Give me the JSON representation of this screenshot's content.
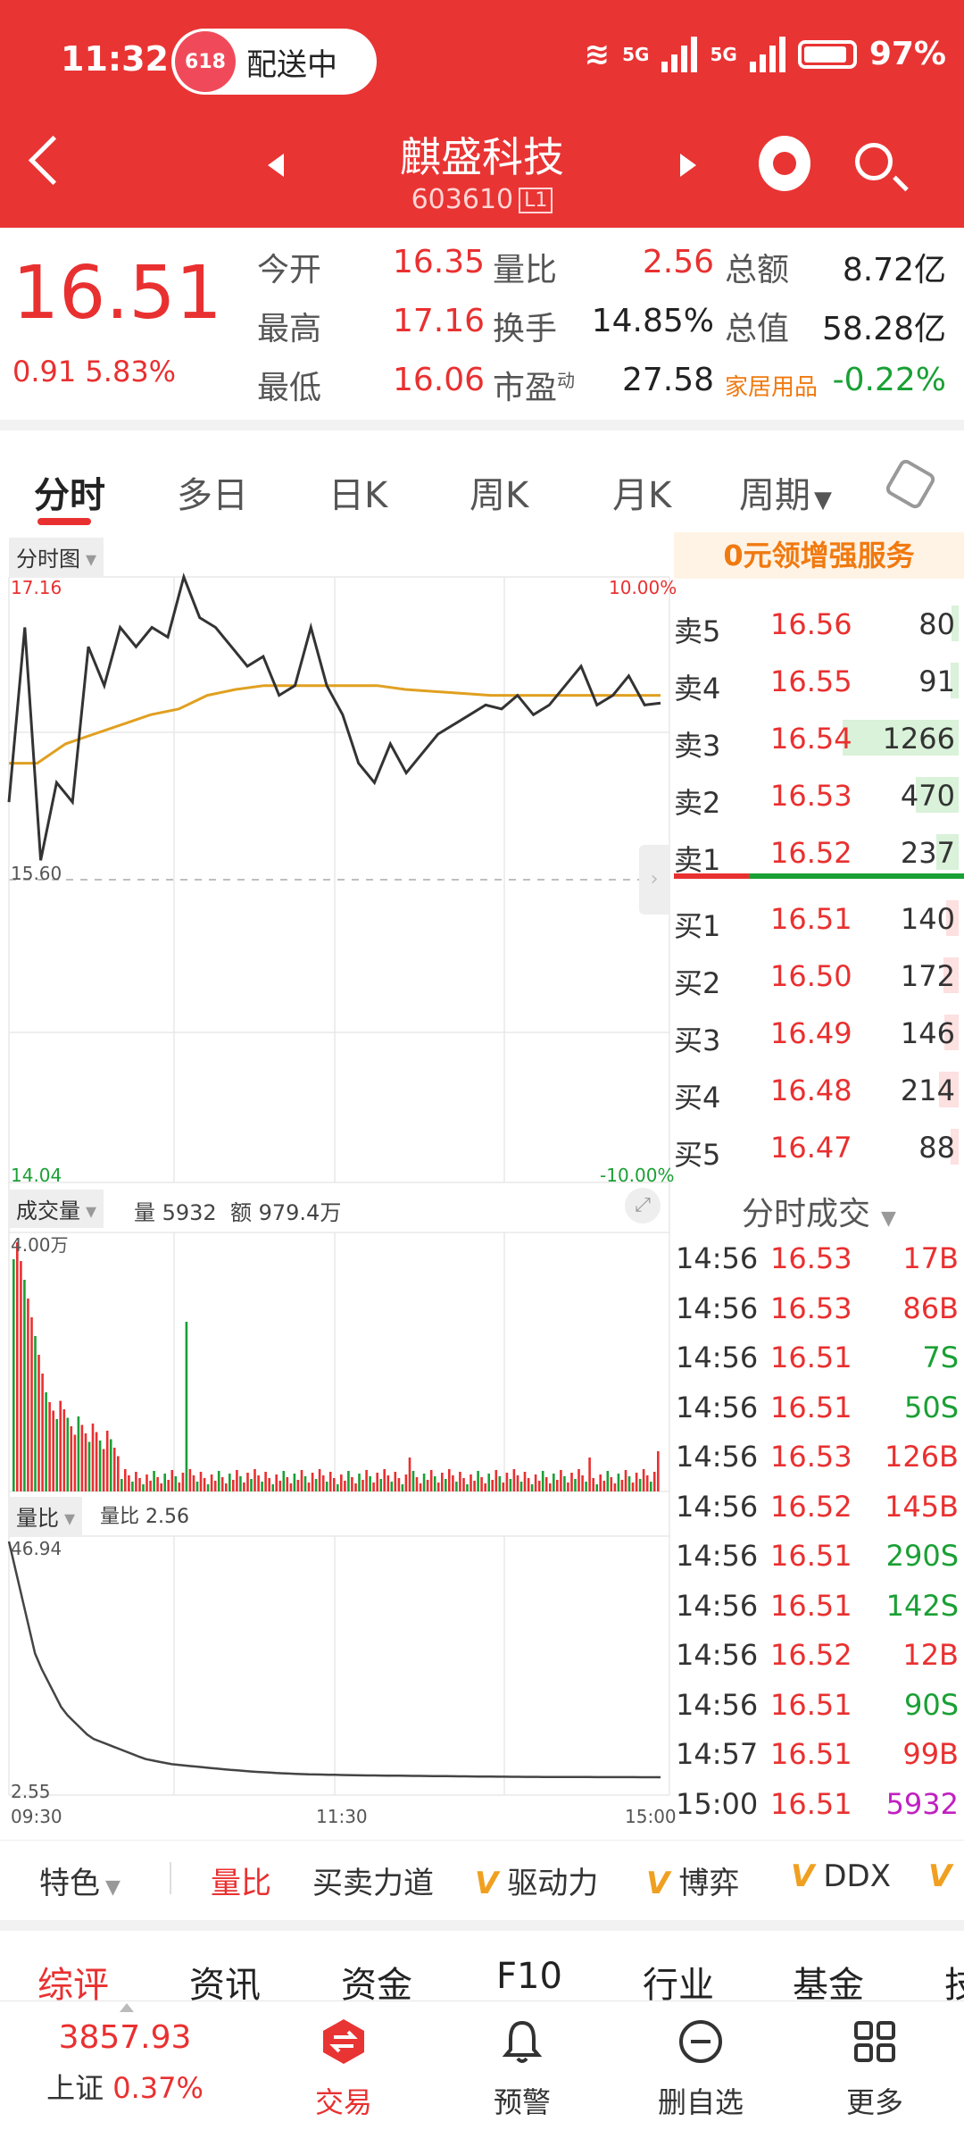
{
  "status_bar": {
    "time": "11:32",
    "delivery_pill": "配送中",
    "pill_logo": "618",
    "network1": "5G",
    "network2": "5G",
    "battery": "97%"
  },
  "header": {
    "title": "麒盛科技",
    "code": "603610",
    "level": "L1"
  },
  "quote": {
    "price": "16.51",
    "change": "0.91",
    "change_pct": "5.83%",
    "rows": [
      [
        {
          "label": "今开",
          "value": "16.35",
          "color": "red"
        },
        {
          "label": "量比",
          "value": "2.56",
          "color": "red"
        },
        {
          "label": "总额",
          "value": "8.72亿",
          "color": "black"
        }
      ],
      [
        {
          "label": "最高",
          "value": "17.16",
          "color": "red"
        },
        {
          "label": "换手",
          "value": "14.85%",
          "color": "black"
        },
        {
          "label": "总值",
          "value": "58.28亿",
          "color": "black"
        }
      ],
      [
        {
          "label": "最低",
          "value": "16.06",
          "color": "red"
        },
        {
          "label": "市盈",
          "sup": "动",
          "value": "27.58",
          "color": "black"
        },
        {
          "label": "家居用品",
          "value": "-0.22%",
          "color": "green"
        }
      ]
    ]
  },
  "tabs": [
    "分时",
    "多日",
    "日K",
    "周K",
    "月K",
    "周期"
  ],
  "chart": {
    "price_badge": "分时图",
    "max_price": "17.16",
    "mid_price": "15.60",
    "min_price": "14.04",
    "max_pct": "10.00%",
    "min_pct": "-10.00%",
    "vol_badge": "成交量",
    "vol_info": "量 5932",
    "amt_info": "额 979.4万",
    "vol_max": "4.00万",
    "ratio_badge": "量比",
    "ratio_info": "量比 2.56",
    "ratio_max": "46.94",
    "ratio_min": "2.55",
    "times": [
      "09:30",
      "11:30",
      "15:00"
    ]
  },
  "chart_data": {
    "type": "line",
    "title": "",
    "ylim": [
      14.04,
      17.16
    ],
    "series": [
      {
        "name": "",
        "values": [
          16.0,
          16.9,
          15.7,
          16.1,
          16.0,
          16.8,
          16.6,
          16.9,
          16.8,
          16.9,
          16.85,
          17.16,
          16.95,
          16.9,
          16.8,
          16.7,
          16.75,
          16.55,
          16.6,
          16.9,
          16.6,
          16.45,
          16.2,
          16.1,
          16.3,
          16.15,
          16.25,
          16.35,
          16.4,
          16.45,
          16.5,
          16.48,
          16.55,
          16.45,
          16.5,
          16.6,
          16.7,
          16.5,
          16.55,
          16.65,
          16.5,
          16.51
        ]
      },
      {
        "name": "",
        "values": [
          16.2,
          16.2,
          16.3,
          16.35,
          16.4,
          16.45,
          16.48,
          16.55,
          16.58,
          16.6,
          16.6,
          16.6,
          16.6,
          16.6,
          16.58,
          16.57,
          16.56,
          16.55,
          16.55,
          16.55,
          16.55,
          16.55,
          16.55,
          16.55
        ]
      }
    ],
    "volume_ratio": [
      46.94,
      25,
      15,
      10,
      8,
      6,
      5,
      4.5,
      4,
      3.6,
      3.3,
      3.1,
      3.0,
      2.9,
      2.85,
      2.8,
      2.75,
      2.7,
      2.65,
      2.62,
      2.6,
      2.58,
      2.57,
      2.56,
      2.55
    ]
  },
  "order_book": {
    "promo": "0元领增强服务",
    "asks": [
      {
        "label": "卖5",
        "price": "16.56",
        "vol": "80",
        "w": 0.06
      },
      {
        "label": "卖4",
        "price": "16.55",
        "vol": "91",
        "w": 0.07
      },
      {
        "label": "卖3",
        "price": "16.54",
        "vol": "1266",
        "w": 1.0
      },
      {
        "label": "卖2",
        "price": "16.53",
        "vol": "470",
        "w": 0.37
      },
      {
        "label": "卖1",
        "price": "16.52",
        "vol": "237",
        "w": 0.19
      }
    ],
    "bids": [
      {
        "label": "买1",
        "price": "16.51",
        "vol": "140",
        "w": 0.11
      },
      {
        "label": "买2",
        "price": "16.50",
        "vol": "172",
        "w": 0.13
      },
      {
        "label": "买3",
        "price": "16.49",
        "vol": "146",
        "w": 0.12
      },
      {
        "label": "买4",
        "price": "16.48",
        "vol": "214",
        "w": 0.17
      },
      {
        "label": "买5",
        "price": "16.47",
        "vol": "88",
        "w": 0.07
      }
    ],
    "trans_title": "分时成交",
    "trades": [
      {
        "t": "14:56",
        "p": "16.53",
        "v": "17B",
        "c": "red"
      },
      {
        "t": "14:56",
        "p": "16.53",
        "v": "86B",
        "c": "red"
      },
      {
        "t": "14:56",
        "p": "16.51",
        "v": "7S",
        "c": "green"
      },
      {
        "t": "14:56",
        "p": "16.51",
        "v": "50S",
        "c": "green"
      },
      {
        "t": "14:56",
        "p": "16.53",
        "v": "126B",
        "c": "red"
      },
      {
        "t": "14:56",
        "p": "16.52",
        "v": "145B",
        "c": "red"
      },
      {
        "t": "14:56",
        "p": "16.51",
        "v": "290S",
        "c": "green"
      },
      {
        "t": "14:56",
        "p": "16.51",
        "v": "142S",
        "c": "green"
      },
      {
        "t": "14:56",
        "p": "16.52",
        "v": "12B",
        "c": "red"
      },
      {
        "t": "14:56",
        "p": "16.51",
        "v": "90S",
        "c": "green"
      },
      {
        "t": "14:57",
        "p": "16.51",
        "v": "99B",
        "c": "red"
      },
      {
        "t": "15:00",
        "p": "16.51",
        "v": "5932",
        "c": "purple"
      }
    ]
  },
  "indicators": [
    "特色",
    "量比",
    "买卖力道",
    "驱动力",
    "博弈",
    "DDX"
  ],
  "indicator_v": "V",
  "sections": [
    "综评",
    "资讯",
    "资金",
    "F10",
    "行业",
    "基金",
    "技"
  ],
  "bottom": {
    "index_value": "3857.93",
    "index_name": "上证",
    "index_pct": "0.37%",
    "nav": [
      "交易",
      "预警",
      "删自选",
      "更多"
    ]
  },
  "colors": {
    "brand_red": "#e93434",
    "up": "#e93030",
    "down": "#1aa035",
    "avg_line": "#e0a020"
  }
}
